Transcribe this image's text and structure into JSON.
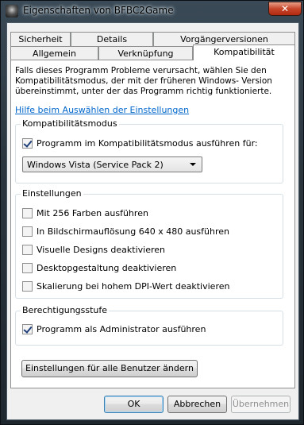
{
  "window": {
    "title": "Eigenschaften von BFBC2Game",
    "close_symbol": "✕"
  },
  "tabs": {
    "row1": [
      "Sicherheit",
      "Details",
      "Vorgängerversionen"
    ],
    "row2": [
      "Allgemein",
      "Verknüpfung",
      "Kompatibilität"
    ],
    "active": "Kompatibilität"
  },
  "intro_text": "Falls dieses Programm Probleme verursacht, wählen Sie den Kompatibilitätsmodus, der mit der früheren Windows- Version übereinstimmt, unter der das Programm richtig funktionierte.",
  "help_link": "Hilfe beim Auswählen der Einstellungen",
  "compat_mode": {
    "label": "Kompatibilitätsmodus",
    "checkbox_label": "Programm im Kompatibilitätsmodus ausführen für:",
    "checked": true,
    "selected_os": "Windows Vista (Service Pack 2)"
  },
  "settings": {
    "label": "Einstellungen",
    "items": [
      {
        "label": "Mit 256 Farben ausführen",
        "checked": false
      },
      {
        "label": "In Bildschirmauflösung 640 x 480 ausführen",
        "checked": false
      },
      {
        "label": "Visuelle Designs deaktivieren",
        "checked": false
      },
      {
        "label": "Desktopgestaltung deaktivieren",
        "checked": false
      },
      {
        "label": "Skalierung bei hohem DPI-Wert deaktivieren",
        "checked": false
      }
    ]
  },
  "privilege": {
    "label": "Berechtigungsstufe",
    "checkbox_label": "Programm als Administrator ausführen",
    "checked": true
  },
  "all_users_button": "Einstellungen für alle Benutzer ändern",
  "buttons": {
    "ok": "OK",
    "cancel": "Abbrechen",
    "apply": "Übernehmen"
  }
}
